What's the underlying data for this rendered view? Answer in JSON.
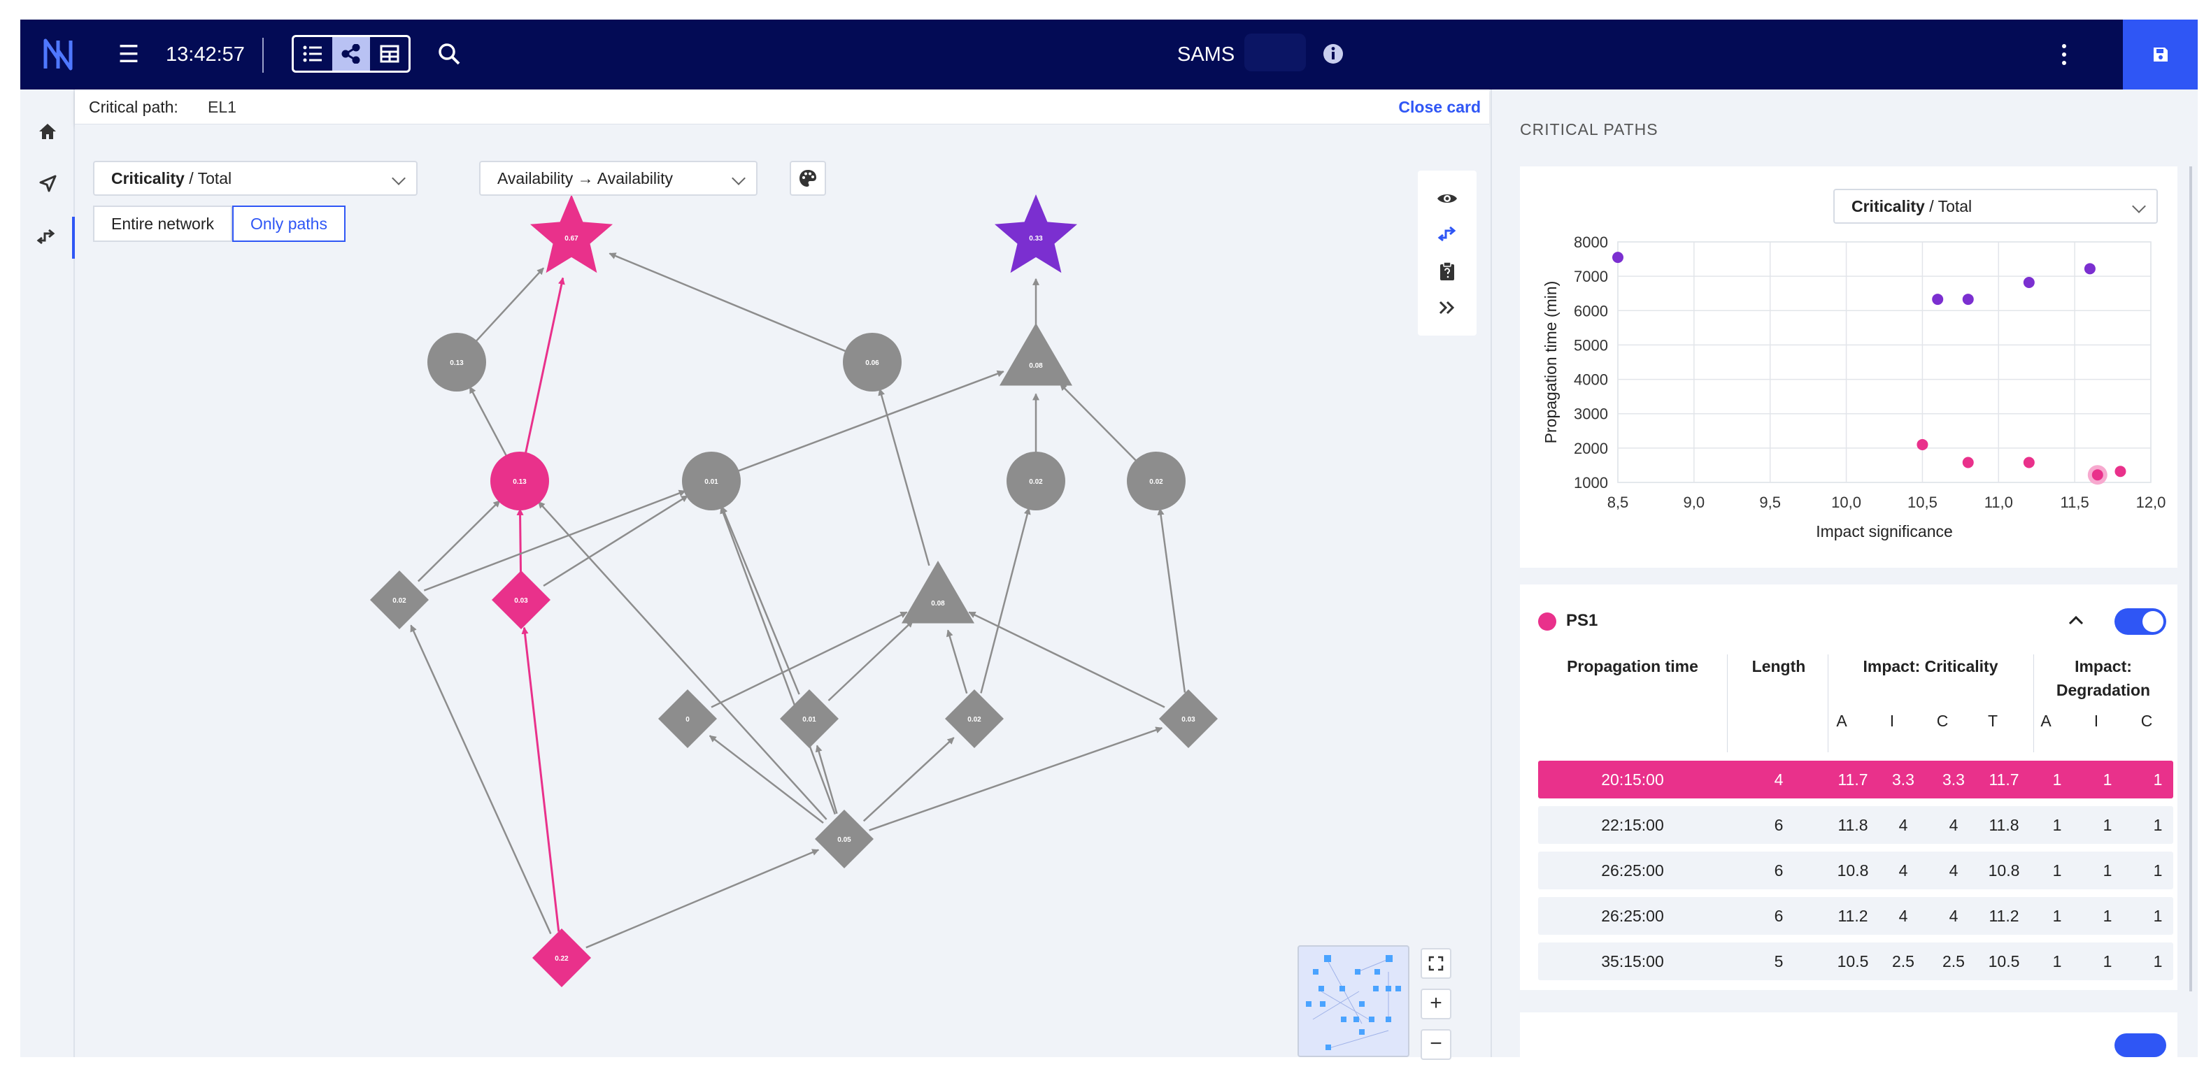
{
  "topbar": {
    "time": "13:42:57",
    "app_title": "SAMS",
    "view_modes": [
      "list-icon",
      "share-icon",
      "table-icon"
    ],
    "active_view": 1,
    "accent": "#2f56f5",
    "bg": "#030b55"
  },
  "rail": {
    "items": [
      "home-icon",
      "send-icon",
      "path-icon"
    ],
    "active": 2
  },
  "card": {
    "label": "Critical path:",
    "value": "EL1",
    "close": "Close card"
  },
  "filters": {
    "criticality_main": "Criticality",
    "criticality_sub": "/ Total",
    "availability_from": "Availability",
    "availability_arrow": "→",
    "availability_to": "Availability",
    "entire_network": "Entire network",
    "only_paths": "Only paths"
  },
  "graph": {
    "colors": {
      "path": "#e9318b",
      "target": "#7b2fd0",
      "node": "#8d8d8d",
      "edge": "#8d8d8d"
    },
    "nodes": [
      {
        "id": "t1",
        "shape": "star",
        "label": "0.67",
        "state": "path"
      },
      {
        "id": "t2",
        "shape": "star",
        "label": "0.33",
        "state": "target"
      },
      {
        "id": "c1",
        "shape": "circle",
        "label": "0.13",
        "state": "normal"
      },
      {
        "id": "c2",
        "shape": "circle",
        "label": "0.06",
        "state": "normal"
      },
      {
        "id": "tr1",
        "shape": "triangle",
        "label": "0.08",
        "state": "normal"
      },
      {
        "id": "c3",
        "shape": "circle",
        "label": "0.13",
        "state": "path"
      },
      {
        "id": "c4",
        "shape": "circle",
        "label": "0.01",
        "state": "normal"
      },
      {
        "id": "c5",
        "shape": "circle",
        "label": "0.02",
        "state": "normal"
      },
      {
        "id": "c6",
        "shape": "circle",
        "label": "0.02",
        "state": "normal"
      },
      {
        "id": "d1",
        "shape": "diamond",
        "label": "0.02",
        "state": "normal"
      },
      {
        "id": "d2",
        "shape": "diamond",
        "label": "0.03",
        "state": "path"
      },
      {
        "id": "tr2",
        "shape": "triangle",
        "label": "0.08",
        "state": "normal"
      },
      {
        "id": "d3",
        "shape": "diamond",
        "label": "0",
        "state": "normal"
      },
      {
        "id": "d4",
        "shape": "diamond",
        "label": "0.01",
        "state": "normal"
      },
      {
        "id": "d5",
        "shape": "diamond",
        "label": "0.02",
        "state": "normal"
      },
      {
        "id": "d6",
        "shape": "diamond",
        "label": "0.03",
        "state": "normal"
      },
      {
        "id": "d7",
        "shape": "diamond",
        "label": "0.05",
        "state": "normal"
      },
      {
        "id": "d8",
        "shape": "diamond",
        "label": "0.22",
        "state": "path"
      }
    ],
    "edges": [
      [
        "c1",
        "t1"
      ],
      [
        "c2",
        "t1"
      ],
      [
        "c3",
        "t1",
        1
      ],
      [
        "tr1",
        "t2"
      ],
      [
        "c3",
        "c1"
      ],
      [
        "tr2",
        "c2"
      ],
      [
        "c4",
        "tr1"
      ],
      [
        "c5",
        "tr1"
      ],
      [
        "c6",
        "tr1"
      ],
      [
        "d1",
        "c3"
      ],
      [
        "d2",
        "c3",
        1
      ],
      [
        "d2",
        "c4"
      ],
      [
        "d1",
        "c4"
      ],
      [
        "d4",
        "c4"
      ],
      [
        "d7",
        "c4"
      ],
      [
        "d3",
        "tr2"
      ],
      [
        "d4",
        "tr2"
      ],
      [
        "d5",
        "tr2"
      ],
      [
        "d6",
        "tr2"
      ],
      [
        "d5",
        "c5"
      ],
      [
        "d6",
        "c6"
      ],
      [
        "d7",
        "c3"
      ],
      [
        "d7",
        "d3"
      ],
      [
        "d7",
        "d4"
      ],
      [
        "d7",
        "d5"
      ],
      [
        "d7",
        "d6"
      ],
      [
        "d8",
        "d7"
      ],
      [
        "d8",
        "d1"
      ],
      [
        "d8",
        "d2",
        1
      ]
    ]
  },
  "panel": {
    "title": "CRITICAL PATHS",
    "chart_selector_main": "Criticality",
    "chart_selector_sub": "/ Total"
  },
  "chart_data": {
    "type": "scatter",
    "xlabel": "Impact significance",
    "ylabel": "Propagation time (min)",
    "xlim": [
      8.5,
      12.0
    ],
    "ylim": [
      1000,
      8000
    ],
    "xticks": [
      "8,5",
      "9,0",
      "9,5",
      "10,0",
      "10,5",
      "11,0",
      "11,5",
      "12,0"
    ],
    "yticks": [
      "8000",
      "7000",
      "6000",
      "5000",
      "4000",
      "3000",
      "2000",
      "1000"
    ],
    "grid": true,
    "series": [
      {
        "color": "#7b2fd0",
        "points": [
          [
            8.5,
            7550
          ],
          [
            10.6,
            6330
          ],
          [
            10.8,
            6330
          ],
          [
            11.2,
            6820
          ],
          [
            11.6,
            7220
          ]
        ]
      },
      {
        "color": "#e9318b",
        "points": [
          [
            10.5,
            2100
          ],
          [
            10.8,
            1580
          ],
          [
            11.2,
            1580
          ],
          [
            11.65,
            1220
          ],
          [
            11.8,
            1320
          ]
        ]
      }
    ],
    "highlight": [
      11.65,
      1220
    ]
  },
  "path_set": {
    "name": "PS1",
    "headers": {
      "prop_time": "Propagation time",
      "length": "Length",
      "impact_crit": "Impact: Criticality",
      "impact_deg_1": "Impact:",
      "impact_deg_2": "Degradation"
    },
    "sub_crit": [
      "A",
      "I",
      "C",
      "T"
    ],
    "sub_deg": [
      "A",
      "I",
      "C"
    ],
    "rows": [
      [
        "20:15:00",
        "4",
        "11.7",
        "3.3",
        "3.3",
        "11.7",
        "1",
        "1",
        "1"
      ],
      [
        "22:15:00",
        "6",
        "11.8",
        "4",
        "4",
        "11.8",
        "1",
        "1",
        "1"
      ],
      [
        "26:25:00",
        "6",
        "10.8",
        "4",
        "4",
        "10.8",
        "1",
        "1",
        "1"
      ],
      [
        "26:25:00",
        "6",
        "11.2",
        "4",
        "4",
        "11.2",
        "1",
        "1",
        "1"
      ],
      [
        "35:15:00",
        "5",
        "10.5",
        "2.5",
        "2.5",
        "10.5",
        "1",
        "1",
        "1"
      ]
    ],
    "selected_row": 0
  }
}
